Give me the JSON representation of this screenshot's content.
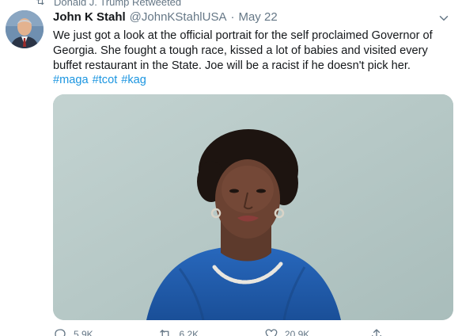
{
  "retweet_context": {
    "label": "Donald J. Trump Retweeted"
  },
  "author": {
    "display_name": "John K Stahl",
    "handle": "@JohnKStahlUSA",
    "separator": "·",
    "date": "May 22"
  },
  "tweet": {
    "text": "We just got a look at the official portrait for the self proclaimed Governor of Georgia. She fought a tough race, kissed a lot of babies and visited every buffet restaurant in the State. Joe will be a racist if he doesn't pick her.",
    "hashtags": [
      "#maga",
      "#tcot",
      "#kag"
    ]
  },
  "actions": {
    "replies": "5.9K",
    "retweets": "6.2K",
    "likes": "20.9K"
  },
  "icons": {
    "retweet_context": "retweet-icon",
    "menu": "chevron-down-icon",
    "reply": "reply-icon",
    "retweet": "retweet-icon",
    "like": "heart-icon",
    "share": "share-icon"
  },
  "colors": {
    "link": "#1b95e0",
    "secondary_text": "#657786",
    "primary_text": "#14171a",
    "photo_background": "#b7c9c7",
    "dress": "#1f5fb0"
  }
}
